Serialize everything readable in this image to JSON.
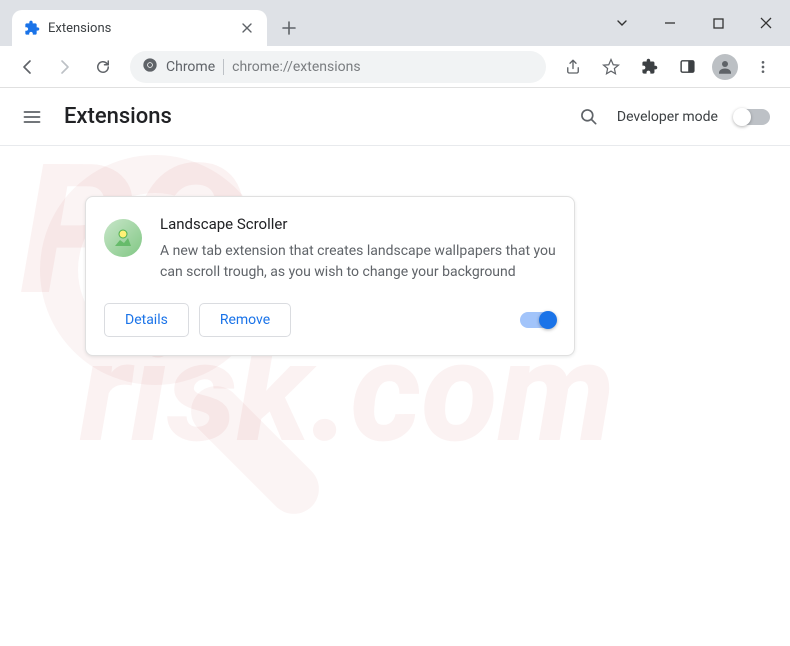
{
  "window": {
    "tab_title": "Extensions"
  },
  "omnibox": {
    "prefix": "Chrome",
    "url": "chrome://extensions"
  },
  "header": {
    "title": "Extensions",
    "devmode_label": "Developer mode"
  },
  "extension": {
    "name": "Landscape Scroller",
    "description": "A new tab extension that creates landscape wallpapers that you can scroll trough, as you wish to change your background",
    "details_label": "Details",
    "remove_label": "Remove",
    "enabled": true
  }
}
